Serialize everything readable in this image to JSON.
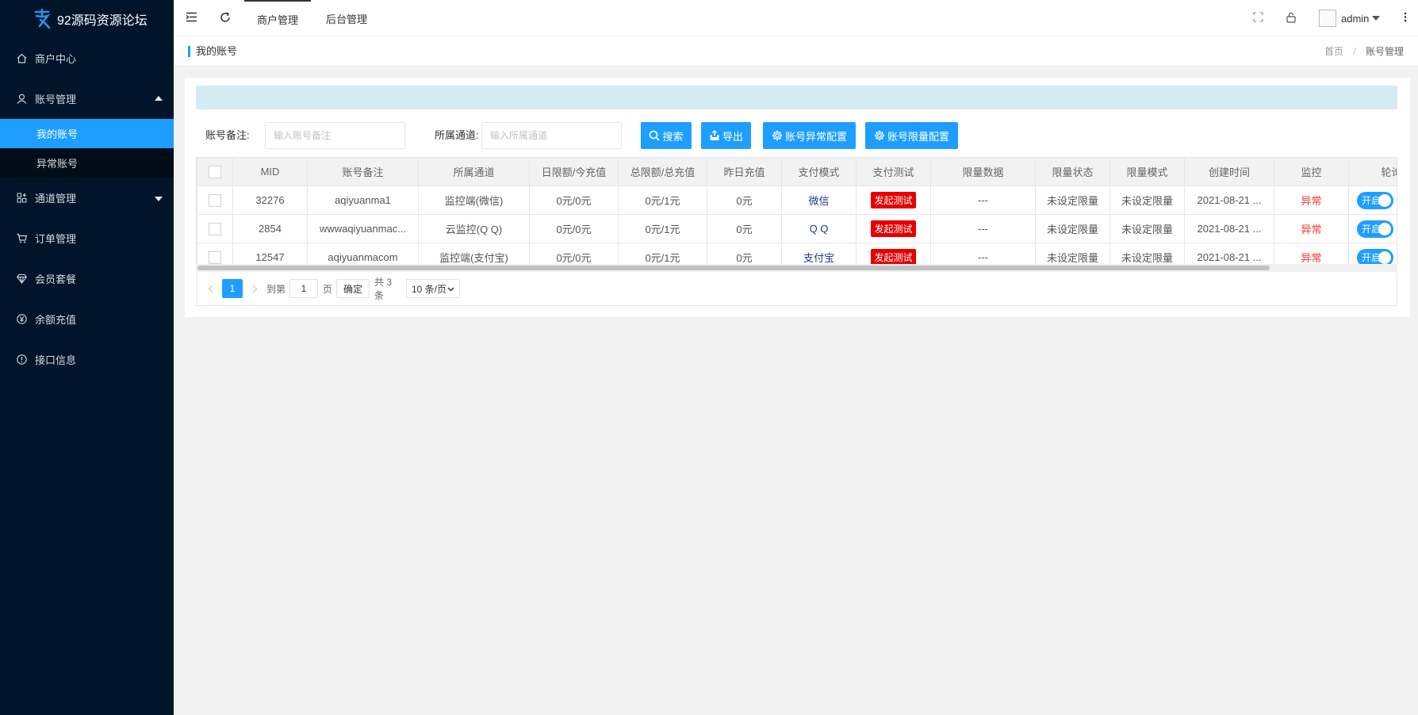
{
  "sidebar": {
    "logo_text": "92源码资源论坛",
    "items": [
      {
        "label": "商户中心",
        "icon": "home-icon"
      },
      {
        "label": "账号管理",
        "icon": "user-icon"
      },
      {
        "label": "通道管理",
        "icon": "apps-icon"
      },
      {
        "label": "订单管理",
        "icon": "cart-icon"
      },
      {
        "label": "会员套餐",
        "icon": "diamond-icon"
      },
      {
        "label": "余额充值",
        "icon": "yen-icon"
      },
      {
        "label": "接口信息",
        "icon": "info-icon"
      }
    ],
    "account_sub": [
      "我的账号",
      "异常账号"
    ]
  },
  "topbar": {
    "tabs": [
      "商户管理",
      "后台管理"
    ],
    "username": "admin"
  },
  "breadcrumb": {
    "title": "我的账号",
    "home": "首页",
    "separator": "/",
    "current": "账号管理"
  },
  "filter": {
    "remark_label": "账号备注:",
    "remark_placeholder": "输入账号备注",
    "channel_label": "所属通道:",
    "channel_placeholder": "输入所属通道",
    "search_btn": "搜索",
    "export_btn": "导出",
    "abnormal_config_btn": "账号异常配置",
    "limit_config_btn": "账号限量配置"
  },
  "table": {
    "columns": [
      "MID",
      "账号备注",
      "所属通道",
      "日限额/今充值",
      "总限额/总充值",
      "昨日充值",
      "支付模式",
      "支付测试",
      "限量数据",
      "限量状态",
      "限量模式",
      "创建时间",
      "监控",
      "轮询"
    ],
    "rows": [
      {
        "mid": "32276",
        "remark": "aqiyuanma1",
        "channel": "监控端(微信)",
        "daily": "0元/0元",
        "total": "0元/1元",
        "yesterday": "0元",
        "pay_mode": "微信",
        "test": "发起测试",
        "limit_data": "---",
        "limit_status": "未设定限量",
        "limit_mode": "未设定限量",
        "created": "2021-08-21 ...",
        "monitor": "异常",
        "poll": "开启"
      },
      {
        "mid": "2854",
        "remark": "wwwaqiyuanmac...",
        "channel": "云监控(Q Q)",
        "daily": "0元/0元",
        "total": "0元/1元",
        "yesterday": "0元",
        "pay_mode": "Q Q",
        "test": "发起测试",
        "limit_data": "---",
        "limit_status": "未设定限量",
        "limit_mode": "未设定限量",
        "created": "2021-08-21 ...",
        "monitor": "异常",
        "poll": "开启"
      },
      {
        "mid": "12547",
        "remark": "aqiyuanmacom",
        "channel": "监控端(支付宝)",
        "daily": "0元/0元",
        "total": "0元/1元",
        "yesterday": "0元",
        "pay_mode": "支付宝",
        "test": "发起测试",
        "limit_data": "---",
        "limit_status": "未设定限量",
        "limit_mode": "未设定限量",
        "created": "2021-08-21 ...",
        "monitor": "异常",
        "poll": "开启"
      }
    ]
  },
  "pager": {
    "current_page": "1",
    "goto_label": "到第",
    "goto_value": "1",
    "page_unit": "页",
    "confirm": "确定",
    "total": "共 3 条",
    "page_size": "10 条/页"
  },
  "colors": {
    "sidebar_bg": "#001529",
    "accent": "#1e9fff",
    "danger": "#e60000"
  }
}
